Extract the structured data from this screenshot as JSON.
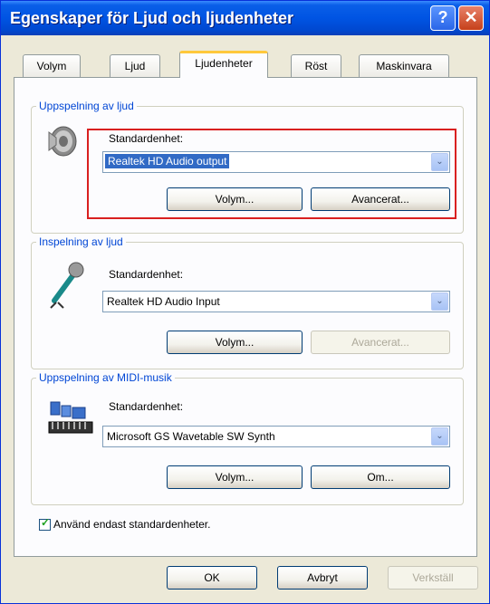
{
  "window": {
    "title": "Egenskaper för Ljud och ljudenheter",
    "help_glyph": "?",
    "close_glyph": "✕"
  },
  "tabs": [
    "Volym",
    "Ljud",
    "Ljudenheter",
    "Röst",
    "Maskinvara"
  ],
  "active_tab": "Ljudenheter",
  "playback": {
    "group_label": "Uppspelning av ljud",
    "device_label": "Standardenhet:",
    "device_value": "Realtek HD Audio output",
    "volume_button": "Volym...",
    "advanced_button": "Avancerat..."
  },
  "recording": {
    "group_label": "Inspelning av ljud",
    "device_label": "Standardenhet:",
    "device_value": "Realtek HD Audio Input",
    "volume_button": "Volym...",
    "advanced_button": "Avancerat..."
  },
  "midi": {
    "group_label": "Uppspelning av MIDI-musik",
    "device_label": "Standardenhet:",
    "device_value": "Microsoft GS Wavetable SW Synth",
    "volume_button": "Volym...",
    "about_button": "Om..."
  },
  "use_default_only": {
    "label": "Använd endast standardenheter.",
    "checked": true
  },
  "footer": {
    "ok_button": "OK",
    "cancel_button": "Avbryt",
    "apply_button": "Verkställ"
  },
  "icons": {
    "dropdown_arrow": "⌄",
    "check_mark": "✓"
  },
  "colors": {
    "titlebar": "#0054e3",
    "group_label": "#0046d5",
    "selection": "#316ac5",
    "highlight_box": "#d92020",
    "active_tab_accent": "#ffc83c"
  }
}
